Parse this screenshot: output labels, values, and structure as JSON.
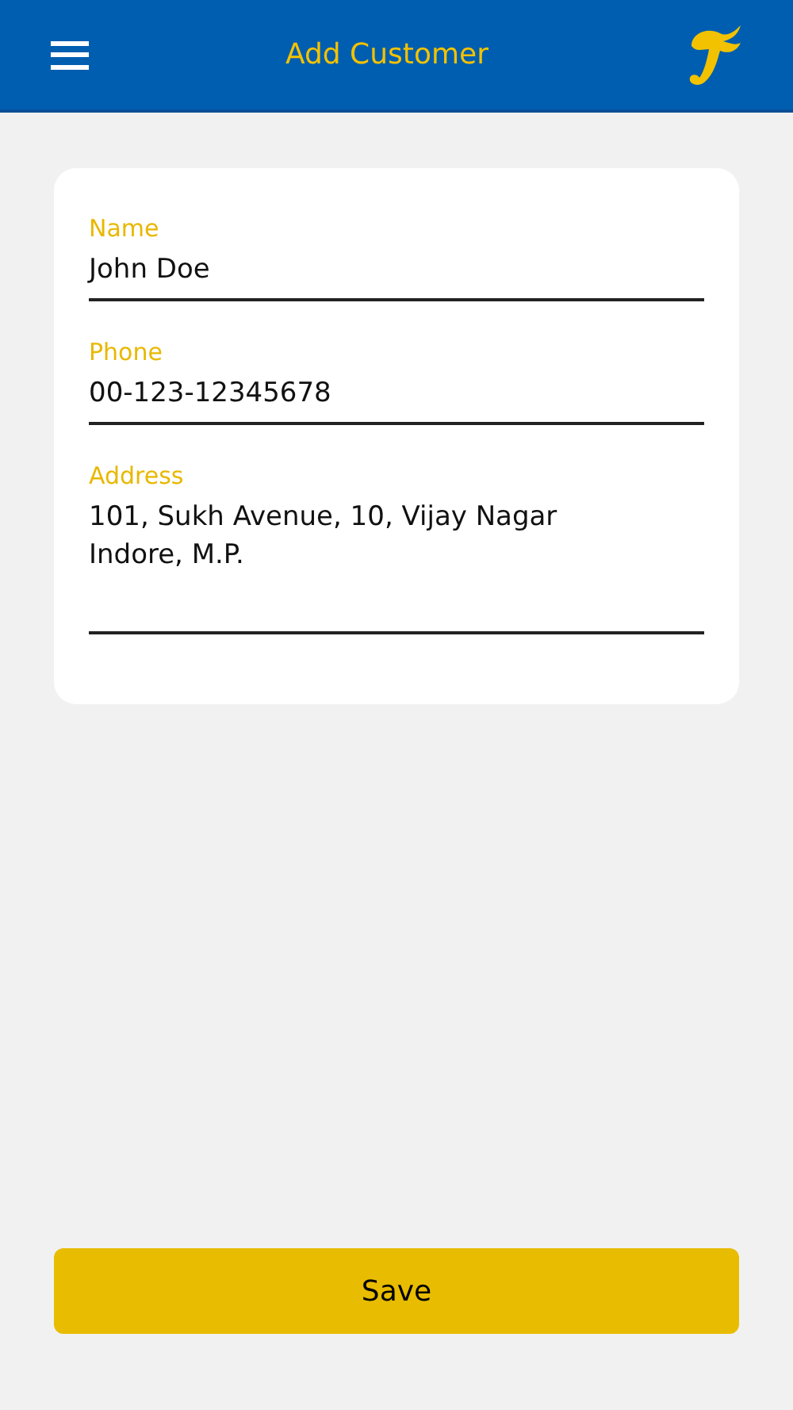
{
  "header": {
    "title": "Add Customer"
  },
  "fields": [
    {
      "label": "Name",
      "value": "John Doe",
      "kind": "single"
    },
    {
      "label": "Phone",
      "value": "00-123-12345678",
      "kind": "single"
    },
    {
      "label": "Address",
      "value": "101, Sukh Avenue, 10, Vijay Nagar\nIndore, M.P.",
      "kind": "multiline"
    }
  ],
  "save_button": "Save"
}
